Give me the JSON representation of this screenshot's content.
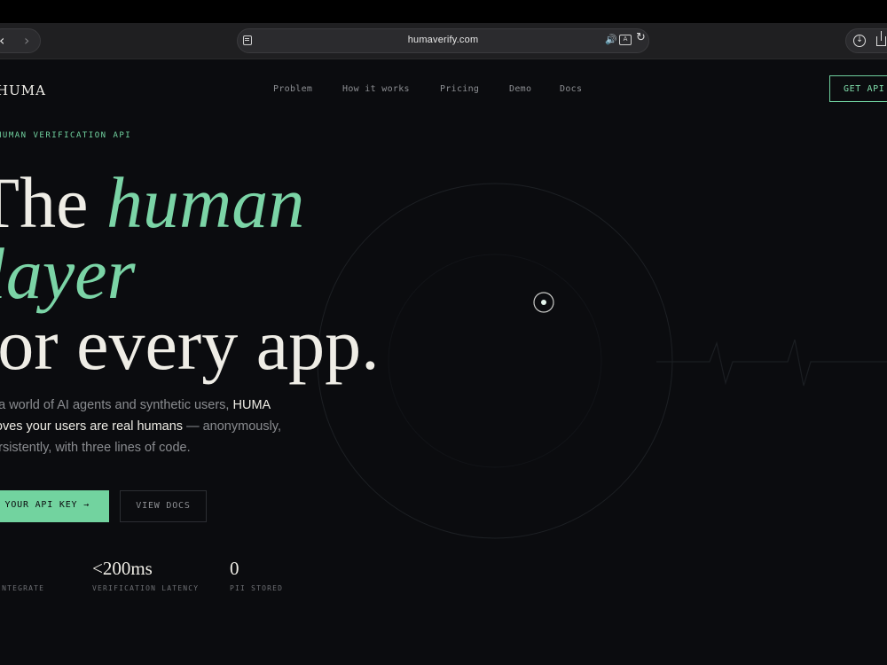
{
  "browser": {
    "url": "humaverify.com",
    "back_icon": "chevron-left-icon",
    "forward_icon": "chevron-right-icon",
    "reader_icon": "reader-icon",
    "speaker_icon": "speaker-icon",
    "translate_icon": "translate-icon",
    "reload_icon": "reload-icon",
    "download_icon": "download-icon",
    "share_icon": "share-icon"
  },
  "site": {
    "logo": "HUMA",
    "nav": [
      "Problem",
      "How it works",
      "Pricing",
      "Demo",
      "Docs"
    ],
    "cta_top": "GET API KEY"
  },
  "hero": {
    "eyebrow": "HUMAN VERIFICATION API",
    "line1_plain": "The ",
    "line1_accent": "human",
    "line2_accent": "layer",
    "line3": "for every app.",
    "sub_1": "In a world of AI agents and synthetic users, ",
    "sub_strong": "HUMA proves your users are real humans",
    "sub_2": " — anonymously, persistently, with three lines of code.",
    "primary_button": "GET YOUR API KEY →",
    "secondary_button": "VIEW DOCS"
  },
  "stats": [
    {
      "value": "",
      "label": "TO INTEGRATE"
    },
    {
      "value": "<200ms",
      "label": "VERIFICATION LATENCY"
    },
    {
      "value": "0",
      "label": "PII STORED"
    }
  ],
  "colors": {
    "accent": "#72d39f",
    "background": "#0b0c0f",
    "text": "#efede6",
    "muted": "#8a8c90"
  }
}
